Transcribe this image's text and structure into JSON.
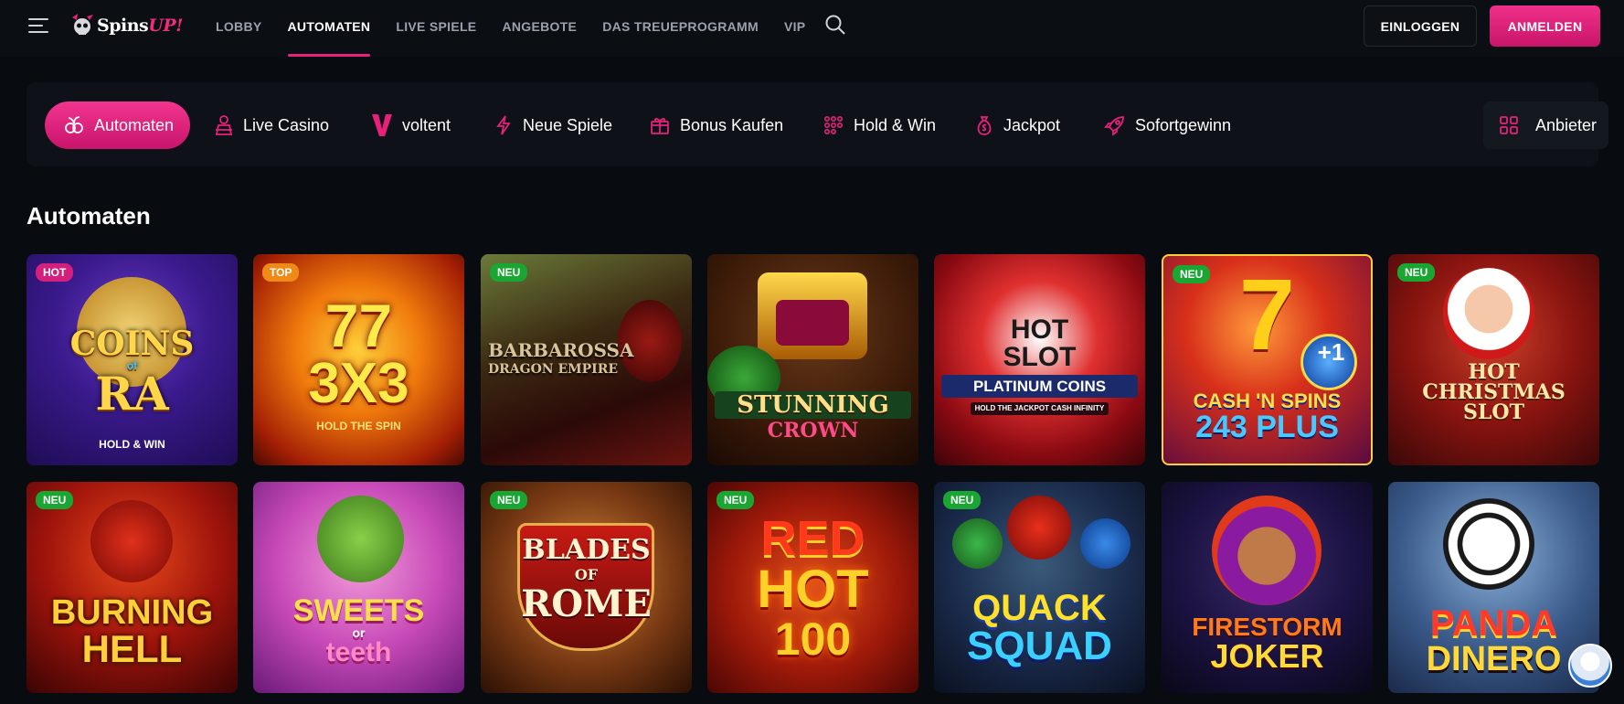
{
  "brand": {
    "name_main": "Spins",
    "name_accent": "UP!"
  },
  "nav": [
    {
      "label": "LOBBY",
      "active": false
    },
    {
      "label": "AUTOMATEN",
      "active": true
    },
    {
      "label": "LIVE SPIELE",
      "active": false
    },
    {
      "label": "ANGEBOTE",
      "active": false
    },
    {
      "label": "DAS TREUEPROGRAMM",
      "active": false
    },
    {
      "label": "VIP",
      "active": false
    }
  ],
  "auth": {
    "login_label": "EINLOGGEN",
    "register_label": "ANMELDEN"
  },
  "categories": [
    {
      "label": "Automaten",
      "icon": "slots-icon",
      "active": true
    },
    {
      "label": "Live Casino",
      "icon": "dealer-icon",
      "active": false
    },
    {
      "label": "voltent",
      "icon": "voltent-v-icon",
      "active": false
    },
    {
      "label": "Neue Spiele",
      "icon": "lightning-icon",
      "active": false
    },
    {
      "label": "Bonus Kaufen",
      "icon": "gift-icon",
      "active": false
    },
    {
      "label": "Hold & Win",
      "icon": "grid-dots-icon",
      "active": false
    },
    {
      "label": "Jackpot",
      "icon": "money-bag-icon",
      "active": false
    },
    {
      "label": "Sofortgewinn",
      "icon": "rocket-icon",
      "active": false
    }
  ],
  "provider": {
    "label": "Anbieter",
    "icon": "grid-icon"
  },
  "section": {
    "title": "Automaten"
  },
  "colors": {
    "accent": "#e8207a",
    "badge_new": "#1aa632",
    "badge_hot": "#d3207c",
    "badge_top": "#f08a17",
    "background": "#080b10"
  },
  "games": [
    {
      "badge": "HOT",
      "title_lines": [
        "COINS",
        "of",
        "RA"
      ],
      "subtitle": "HOLD & WIN"
    },
    {
      "badge": "TOP",
      "title_lines": [
        "77",
        "3X3"
      ],
      "subtitle": "HOLD THE SPIN"
    },
    {
      "badge": "NEU",
      "title_lines": [
        "BARBAROSSA",
        "DRAGON EMPIRE"
      ],
      "subtitle": ""
    },
    {
      "badge": "",
      "title_lines": [
        "STUNNING",
        "CROWN"
      ],
      "subtitle": ""
    },
    {
      "badge": "",
      "title_lines": [
        "HOT",
        "SLOT",
        "PLATINUM COINS"
      ],
      "subtitle": "HOLD THE JACKPOT CASH INFINITY"
    },
    {
      "badge": "NEU",
      "title_lines": [
        "7",
        "CASH 'N SPINS",
        "243 PLUS"
      ],
      "subtitle": "+1"
    },
    {
      "badge": "NEU",
      "title_lines": [
        "HOT",
        "CHRISTMAS",
        "SLOT"
      ],
      "subtitle": ""
    },
    {
      "badge": "NEU",
      "title_lines": [
        "BURNING",
        "HELL"
      ],
      "subtitle": ""
    },
    {
      "badge": "",
      "title_lines": [
        "SWEETS",
        "or",
        "teeth"
      ],
      "subtitle": ""
    },
    {
      "badge": "NEU",
      "title_lines": [
        "BLADES",
        "OF",
        "ROME"
      ],
      "subtitle": ""
    },
    {
      "badge": "NEU",
      "title_lines": [
        "RED",
        "HOT",
        "100"
      ],
      "subtitle": ""
    },
    {
      "badge": "NEU",
      "title_lines": [
        "QUACK",
        "SQUAD"
      ],
      "subtitle": ""
    },
    {
      "badge": "",
      "title_lines": [
        "FIRESTORM",
        "JOKER"
      ],
      "subtitle": ""
    },
    {
      "badge": "",
      "title_lines": [
        "PANDA",
        "DINERO"
      ],
      "subtitle": ""
    }
  ]
}
